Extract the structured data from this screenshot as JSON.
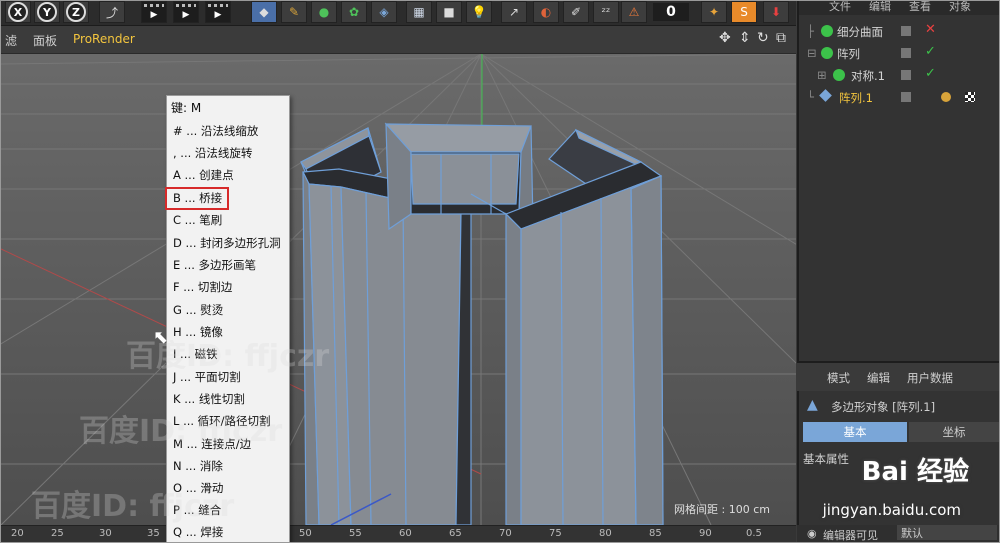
{
  "toolbar": {
    "axis_buttons": [
      "X",
      "Y",
      "Z"
    ],
    "frame_number": "0"
  },
  "menubar": {
    "items": [
      "滤",
      "面板",
      "ProRender"
    ]
  },
  "context_menu": {
    "header": "键:  M",
    "items": [
      "# ... 沿法线缩放",
      ", ... 沿法线旋转",
      "A ... 创建点",
      "B ... 桥接",
      "C ... 笔刷",
      "D ... 封闭多边形孔洞",
      "E ... 多边形画笔",
      "F ... 切割边",
      "G ... 熨烫",
      "H ... 镜像",
      "I ... 磁铁",
      "J ... 平面切割",
      "K ... 线性切割",
      "L ... 循环/路径切割",
      "M ... 连接点/边",
      "N ... 消除",
      "O ... 滑动",
      "P ... 缝合",
      "Q ... 焊接"
    ],
    "highlighted_item": "B ... 桥接"
  },
  "viewport": {
    "grid_spacing_label": "网格间距 : 100 cm"
  },
  "ruler": {
    "ticks": [
      "20",
      "25",
      "30",
      "35",
      "45",
      "50",
      "55",
      "60",
      "65",
      "70",
      "75",
      "80",
      "85",
      "90",
      "0.5"
    ]
  },
  "right_panel": {
    "top_menu": [
      "文件",
      "编辑",
      "查看",
      "对象"
    ],
    "objects": [
      {
        "name": "细分曲面",
        "icon_color": "#3cc24a",
        "status": "✕",
        "status_color": "#e84040"
      },
      {
        "name": "阵列",
        "icon_color": "#3cc24a",
        "status": "✓",
        "status_color": "#3cc24a"
      },
      {
        "name": "对称.1",
        "icon_color": "#3cc24a",
        "status": "✓",
        "status_color": "#3cc24a"
      },
      {
        "name": "阵列.1",
        "icon_color": "#7aa6d8",
        "status": "",
        "status_color": "#3cc24a",
        "selected": true
      }
    ],
    "attr_menu": [
      "模式",
      "编辑",
      "用户数据"
    ],
    "attr_title": "多边形对象 [阵列.1]",
    "tabs": [
      "基本",
      "坐标"
    ],
    "section_label": "基本属性",
    "bottom_label": "编辑器可见",
    "bottom_value": "默认"
  },
  "watermarks": {
    "baidu_id": "百度ID: ffjczr",
    "baidu_logo": "Bai 经验",
    "baidu_url": "jingyan.baidu.com"
  },
  "colors": {
    "highlight_border": "#d72a2a",
    "accent_yellow": "#f3c53e",
    "selection_blue": "#7aa6d8",
    "mesh_blue": "#6f9fd8"
  }
}
